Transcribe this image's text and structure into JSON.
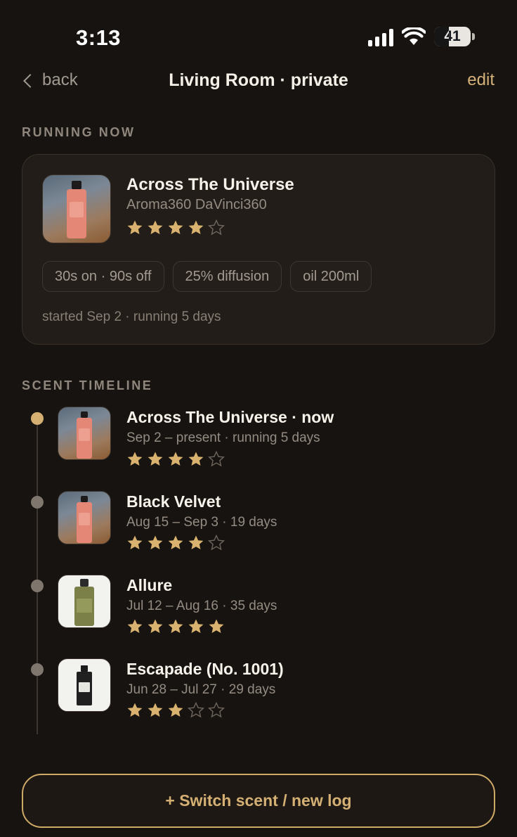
{
  "status_bar": {
    "time": "3:13",
    "battery": "41",
    "battery_level": 0.41
  },
  "nav": {
    "back_label": "back",
    "title": "Living Room · private",
    "edit_label": "edit"
  },
  "running_now": {
    "section_label": "RUNNING NOW",
    "name": "Across The Universe",
    "brand": "Aroma360 DaVinci360",
    "rating": 4,
    "max_rating": 5,
    "chips": [
      "30s on · 90s off",
      "25% diffusion",
      "oil 200ml"
    ],
    "started_text": "started Sep 2 · running 5 days"
  },
  "timeline": {
    "section_label": "SCENT TIMELINE",
    "items": [
      {
        "name": "Across The Universe · now",
        "dates": "Sep 2 – present · running 5 days",
        "rating": 4,
        "active": true,
        "thumb": "pink-bottle"
      },
      {
        "name": "Black Velvet",
        "dates": "Aug 15 – Sep 3 · 19 days",
        "rating": 4,
        "active": false,
        "thumb": "pink-bottle"
      },
      {
        "name": "Allure",
        "dates": "Jul 12 – Aug 16 · 35 days",
        "rating": 5,
        "active": false,
        "thumb": "green-bottle"
      },
      {
        "name": "Escapade (No. 1001)",
        "dates": "Jun 28 – Jul 27 · 29 days",
        "rating": 3,
        "active": false,
        "thumb": "black-bottle"
      }
    ]
  },
  "switch_button": {
    "label": "+ Switch scent / new log"
  },
  "colors": {
    "accent": "#d6b072",
    "background": "#171310",
    "card": "#221d19",
    "star_filled": "#d9b26f",
    "star_empty": "#6e665d"
  }
}
